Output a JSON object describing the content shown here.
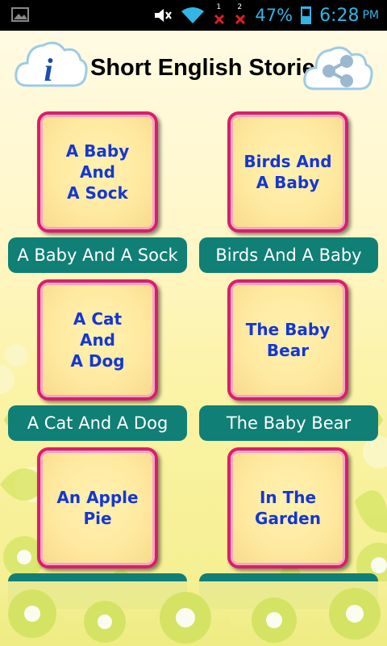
{
  "status_bar": {
    "battery": "47%",
    "time": "6:28",
    "ampm": "PM",
    "notif_1": "1",
    "notif_2": "2"
  },
  "header": {
    "title": "Short English Stories",
    "info_icon": "info-cloud-icon",
    "share_icon": "share-cloud-icon"
  },
  "stories": [
    {
      "tile": "A Baby\nAnd\nA Sock",
      "label": "A Baby And A Sock"
    },
    {
      "tile": "Birds And\nA Baby",
      "label": "Birds And A Baby"
    },
    {
      "tile": "A Cat\nAnd\nA Dog",
      "label": "A Cat And A Dog"
    },
    {
      "tile": "The Baby\nBear",
      "label": "The Baby Bear"
    },
    {
      "tile": "An Apple\nPie",
      "label": ""
    },
    {
      "tile": "In The\nGarden",
      "label": ""
    }
  ],
  "colors": {
    "accent": "#107f76",
    "tile_border": "#d81f6a",
    "tile_text": "#1437d4",
    "status": "#33b5e5"
  }
}
